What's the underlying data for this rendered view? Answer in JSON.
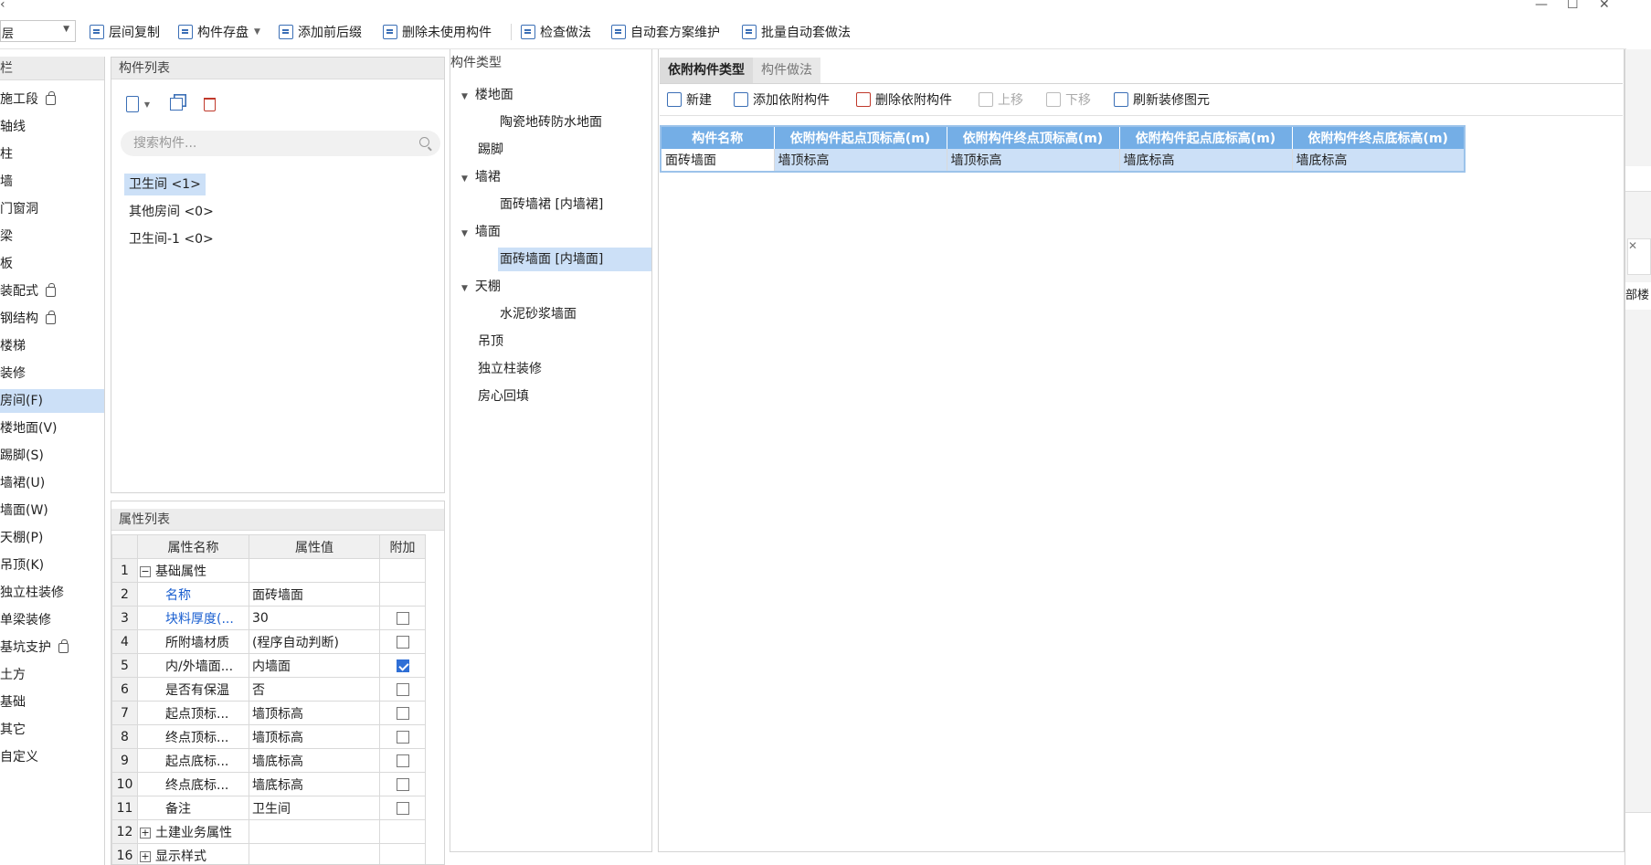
{
  "toolbar": {
    "combo_value": "层",
    "items": [
      "层间复制",
      "构件存盘",
      "添加前后缀",
      "删除未使用构件",
      "检查做法",
      "自动套方案维护",
      "批量自动套做法"
    ]
  },
  "nav": {
    "header": "栏",
    "items": [
      "施工段",
      "轴线",
      "柱",
      "墙",
      "门窗洞",
      "梁",
      "板",
      "装配式",
      "钢结构",
      "楼梯",
      "装修",
      "房间(F)",
      "楼地面(V)",
      "踢脚(S)",
      "墙裙(U)",
      "墙面(W)",
      "天棚(P)",
      "吊顶(K)",
      "独立柱装修",
      "单梁装修",
      "基坑支护",
      "土方",
      "基础",
      "其它",
      "自定义"
    ]
  },
  "component_list": {
    "title": "构件列表",
    "search_placeholder": "搜索构件...",
    "items": [
      "卫生间 <1>",
      "其他房间 <0>",
      "卫生间-1 <0>"
    ]
  },
  "property_list": {
    "title": "属性列表",
    "headers": [
      "属性名称",
      "属性值",
      "附加"
    ],
    "rows": [
      {
        "num": "1",
        "name": "基础属性",
        "value": ""
      },
      {
        "num": "2",
        "name": "名称",
        "value": "面砖墙面"
      },
      {
        "num": "3",
        "name": "块料厚度(...",
        "value": "30"
      },
      {
        "num": "4",
        "name": "所附墙材质",
        "value": "(程序自动判断)"
      },
      {
        "num": "5",
        "name": "内/外墙面...",
        "value": "内墙面"
      },
      {
        "num": "6",
        "name": "是否有保温",
        "value": "否"
      },
      {
        "num": "7",
        "name": "起点顶标...",
        "value": "墙顶标高"
      },
      {
        "num": "8",
        "name": "终点顶标...",
        "value": "墙顶标高"
      },
      {
        "num": "9",
        "name": "起点底标...",
        "value": "墙底标高"
      },
      {
        "num": "10",
        "name": "终点底标...",
        "value": "墙底标高"
      },
      {
        "num": "11",
        "name": "备注",
        "value": "卫生间"
      },
      {
        "num": "12",
        "name": "土建业务属性",
        "value": ""
      },
      {
        "num": "16",
        "name": "显示样式",
        "value": ""
      }
    ]
  },
  "component_type": {
    "title": "构件类型",
    "tree": [
      "楼地面",
      "陶瓷地砖防水地面",
      "踢脚",
      "墙裙",
      "面砖墙裙 [内墙裙]",
      "墙面",
      "面砖墙面 [内墙面]",
      "天棚",
      "水泥砂浆墙面",
      "吊顶",
      "独立柱装修",
      "房心回填"
    ]
  },
  "detail": {
    "tabs": [
      "依附构件类型",
      "构件做法"
    ],
    "tools": [
      "新建",
      "添加依附构件",
      "删除依附构件",
      "上移",
      "下移",
      "刷新装修图元"
    ],
    "table_headers": [
      "构件名称",
      "依附构件起点顶标高(m)",
      "依附构件终点顶标高(m)",
      "依附构件起点底标高(m)",
      "依附构件终点底标高(m)"
    ],
    "table_rows": [
      [
        "面砖墙面",
        "墙顶标高",
        "墙顶标高",
        "墙底标高",
        "墙底标高"
      ]
    ]
  },
  "right_edge": {
    "label": "部楼"
  }
}
